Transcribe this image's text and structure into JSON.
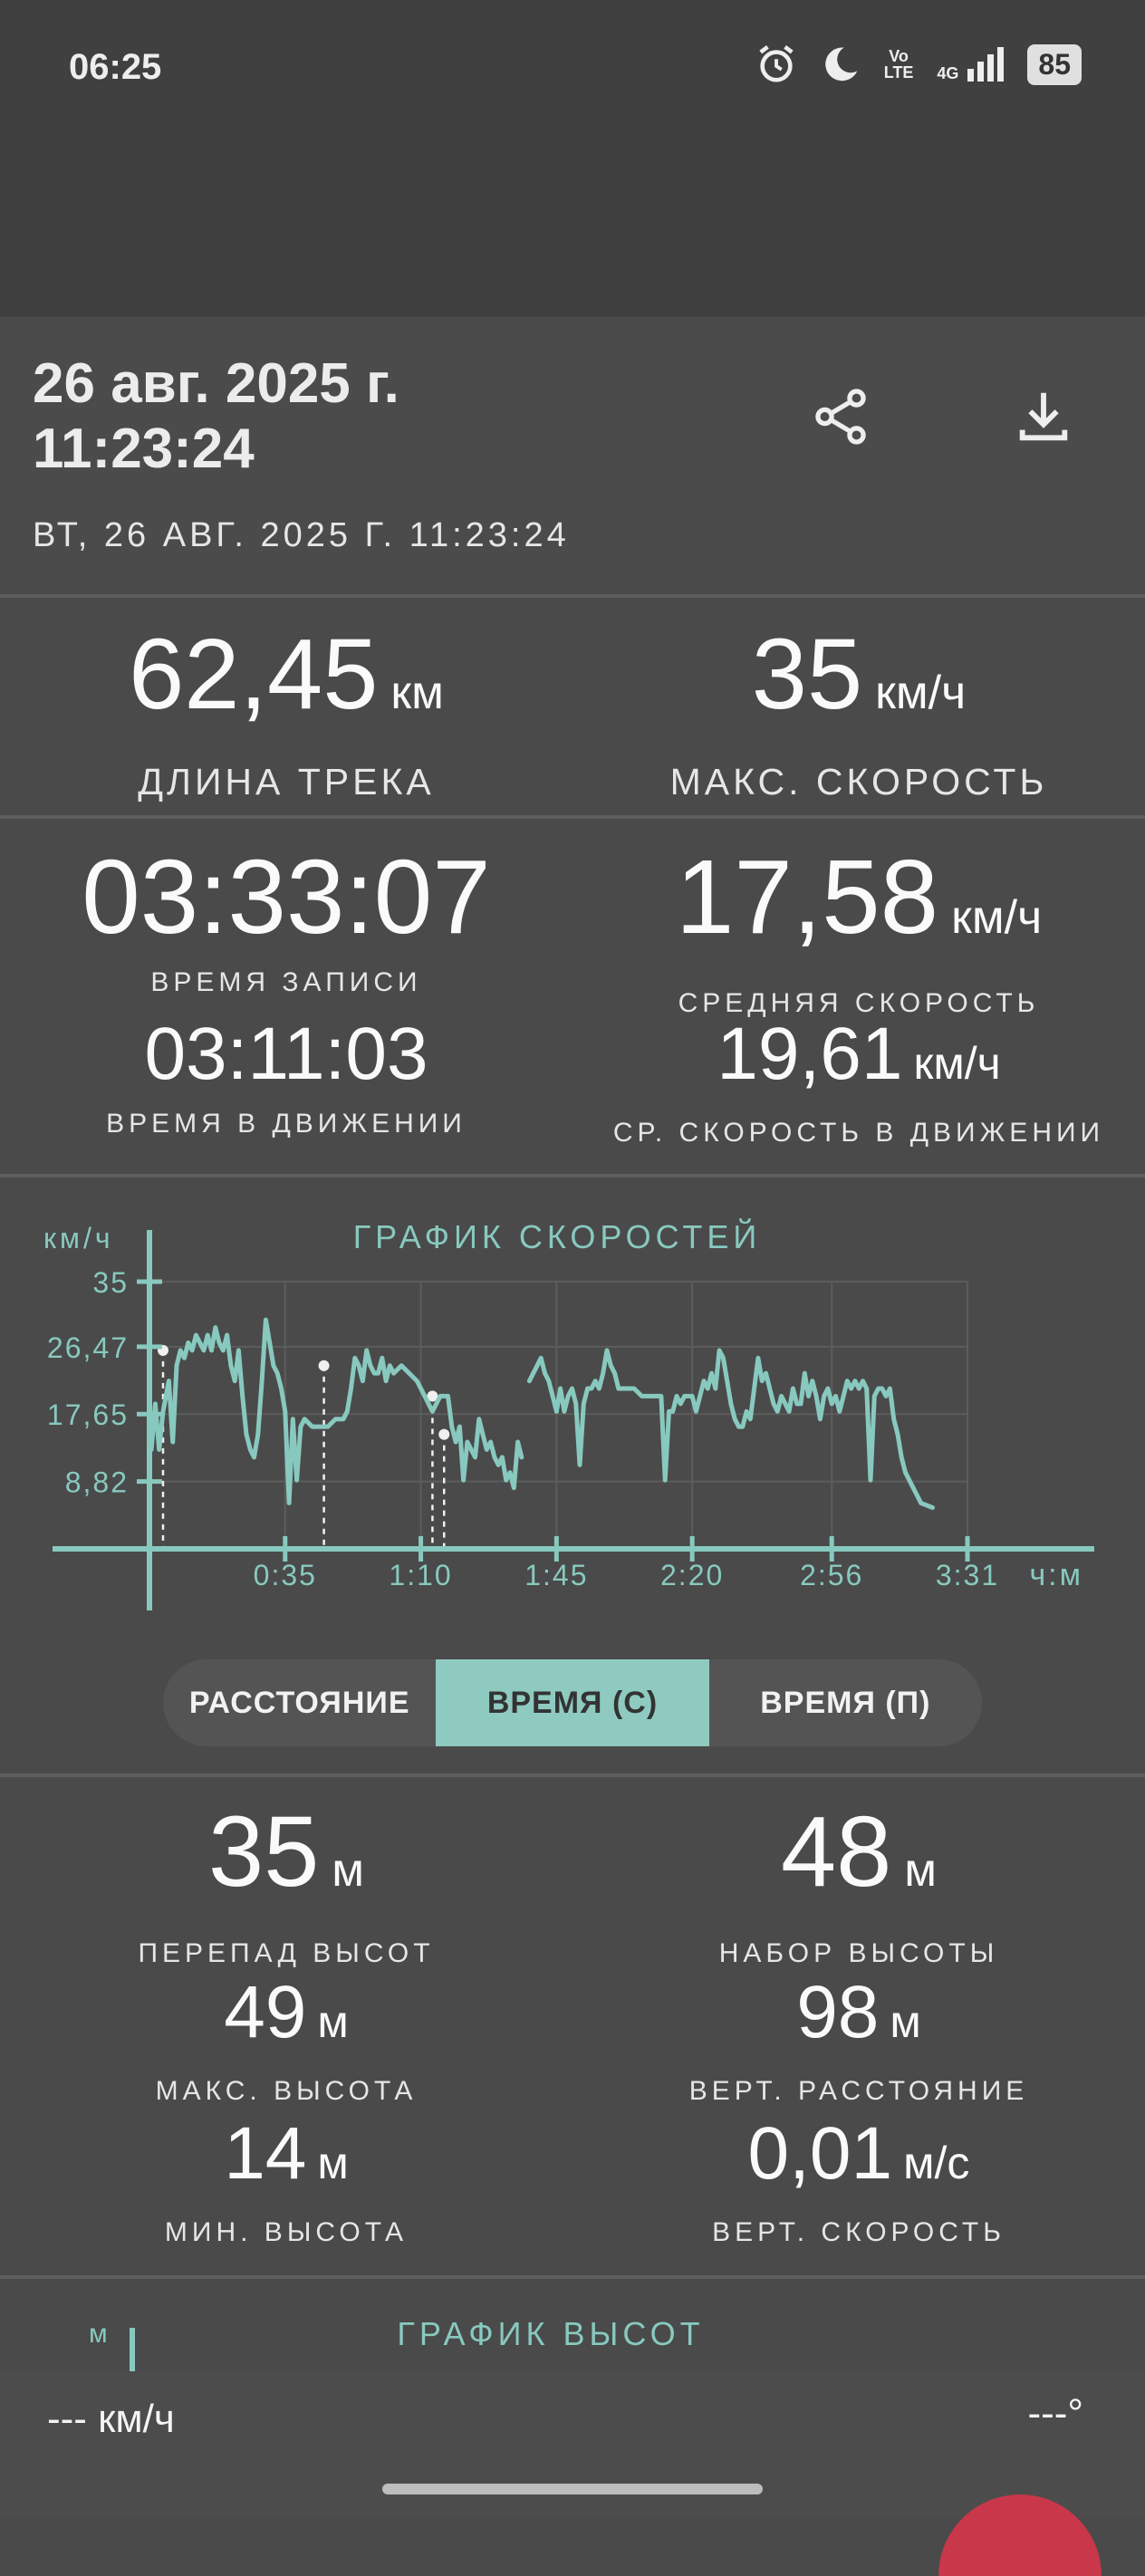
{
  "status_bar": {
    "time": "06:25",
    "icons": [
      "alarm-icon",
      "moon-icon",
      "volte-icon",
      "4g-icon",
      "signal-icon"
    ],
    "volte_top": "Vo",
    "volte_bottom": "LTE",
    "network": "4G",
    "battery": "85"
  },
  "header": {
    "title": "26 авг. 2025 г. 11:23:24",
    "subtitle": "ВТ, 26 АВГ. 2025 Г. 11:23:24",
    "share_icon": "share-icon",
    "download_icon": "download-icon"
  },
  "stats": {
    "track_length": {
      "value": "62,45",
      "unit": "км",
      "label": "ДЛИНА ТРЕКА"
    },
    "max_speed": {
      "value": "35",
      "unit": "км/ч",
      "label": "МАКС. СКОРОСТЬ"
    },
    "record_time": {
      "value": "03:33:07",
      "label": "ВРЕМЯ ЗАПИСИ"
    },
    "avg_speed": {
      "value": "17,58",
      "unit": "км/ч",
      "label": "СРЕДНЯЯ СКОРОСТЬ"
    },
    "moving_time": {
      "value": "03:11:03",
      "label": "ВРЕМЯ В ДВИЖЕНИИ"
    },
    "avg_moving_speed": {
      "value": "19,61",
      "unit": "км/ч",
      "label": "СР. СКОРОСТЬ В ДВИЖЕНИИ"
    }
  },
  "chart_data": {
    "type": "line",
    "title": "ГРАФИК СКОРОСТЕЙ",
    "ylabel": "км/ч",
    "xlabel": "ч:м",
    "y_ticks": [
      "35",
      "26,47",
      "17,65",
      "8,82"
    ],
    "x_ticks": [
      "0:35",
      "1:10",
      "1:45",
      "2:20",
      "2:56",
      "3:31"
    ],
    "ylim": [
      0,
      35
    ],
    "xlim_minutes": [
      0,
      211
    ],
    "grid": true,
    "color": "#88c9bf",
    "series": [
      {
        "points": [
          [
            0.5,
            13
          ],
          [
            1.5,
            19
          ],
          [
            2.5,
            13
          ],
          [
            3.5,
            18
          ],
          [
            5,
            22
          ],
          [
            6,
            14
          ],
          [
            7,
            24
          ],
          [
            8,
            26
          ],
          [
            9,
            25
          ],
          [
            10,
            27
          ],
          [
            11,
            26
          ],
          [
            12,
            28
          ],
          [
            13,
            27
          ],
          [
            14,
            26
          ],
          [
            15,
            28
          ],
          [
            16,
            26
          ],
          [
            17,
            29
          ],
          [
            18,
            27
          ],
          [
            19,
            26
          ],
          [
            20,
            28
          ],
          [
            21,
            24
          ],
          [
            22,
            22
          ],
          [
            23,
            26
          ],
          [
            24,
            20
          ],
          [
            25,
            15
          ],
          [
            26,
            13
          ],
          [
            27,
            12
          ],
          [
            28,
            15
          ],
          [
            29,
            22
          ],
          [
            30,
            30
          ],
          [
            31,
            27
          ],
          [
            32,
            24
          ],
          [
            33,
            23
          ],
          [
            34,
            21
          ],
          [
            35,
            18
          ],
          [
            36,
            6
          ],
          [
            37,
            17
          ],
          [
            38,
            9
          ],
          [
            39,
            16
          ],
          [
            40,
            17
          ],
          [
            42,
            16
          ],
          [
            44,
            16
          ],
          [
            46,
            16
          ],
          [
            48,
            17
          ],
          [
            50,
            17
          ],
          [
            51,
            18
          ],
          [
            52,
            21
          ],
          [
            53,
            25
          ],
          [
            54,
            24
          ],
          [
            55,
            22
          ],
          [
            56,
            26
          ],
          [
            57,
            24
          ],
          [
            58,
            23
          ],
          [
            59,
            23
          ],
          [
            60,
            25
          ],
          [
            61,
            22
          ],
          [
            62,
            24
          ],
          [
            63,
            23
          ],
          [
            65,
            24
          ],
          [
            67,
            23
          ],
          [
            69,
            22
          ],
          [
            71,
            20
          ],
          [
            72,
            19
          ],
          [
            73,
            18
          ],
          [
            75,
            20
          ],
          [
            77,
            20
          ],
          [
            78,
            16
          ],
          [
            79,
            14
          ],
          [
            80,
            16
          ],
          [
            81,
            9
          ],
          [
            82,
            14
          ],
          [
            83,
            13
          ],
          [
            84,
            12
          ],
          [
            85,
            17
          ],
          [
            86,
            15
          ],
          [
            87,
            13
          ],
          [
            88,
            14
          ],
          [
            89,
            12
          ],
          [
            90,
            11
          ],
          [
            91,
            12
          ],
          [
            92,
            9
          ],
          [
            93,
            10
          ],
          [
            94,
            8
          ],
          [
            95,
            14
          ],
          [
            96,
            12
          ],
          null,
          [
            98,
            22
          ],
          [
            99,
            23
          ],
          [
            100,
            24
          ],
          [
            101,
            25
          ],
          [
            102,
            23
          ],
          [
            103,
            22
          ],
          [
            104,
            20
          ],
          [
            105,
            18
          ],
          [
            106,
            21
          ],
          [
            107,
            18
          ],
          [
            108,
            20
          ],
          [
            109,
            21
          ],
          [
            110,
            19
          ],
          [
            111,
            11
          ],
          [
            112,
            19
          ],
          [
            113,
            21
          ],
          [
            114,
            21
          ],
          [
            115,
            22
          ],
          [
            116,
            21
          ],
          [
            117,
            23
          ],
          [
            118,
            26
          ],
          [
            119,
            24
          ],
          [
            120,
            23
          ],
          [
            121,
            21
          ],
          [
            123,
            21
          ],
          [
            125,
            21
          ],
          [
            127,
            20
          ],
          [
            129,
            20
          ],
          [
            131,
            20
          ],
          [
            132,
            20
          ],
          [
            133,
            9
          ],
          [
            134,
            18
          ],
          [
            135,
            18
          ],
          [
            136,
            20
          ],
          [
            137,
            19
          ],
          [
            138,
            20
          ],
          [
            139,
            20
          ],
          [
            140,
            20
          ],
          [
            141,
            18
          ],
          [
            142,
            20
          ],
          [
            143,
            22
          ],
          [
            144,
            21
          ],
          [
            145,
            23
          ],
          [
            146,
            21
          ],
          [
            147,
            26
          ],
          [
            148,
            25
          ],
          [
            149,
            22
          ],
          [
            150,
            19
          ],
          [
            151,
            17
          ],
          [
            152,
            16
          ],
          [
            153,
            16
          ],
          [
            154,
            18
          ],
          [
            155,
            17
          ],
          [
            156,
            21
          ],
          [
            157,
            25
          ],
          [
            158,
            22
          ],
          [
            159,
            23
          ],
          [
            160,
            21
          ],
          [
            161,
            19
          ],
          [
            162,
            18
          ],
          [
            163,
            20
          ],
          [
            164,
            19
          ],
          [
            165,
            18
          ],
          [
            166,
            21
          ],
          [
            167,
            19
          ],
          [
            168,
            19
          ],
          [
            169,
            23
          ],
          [
            170,
            20
          ],
          [
            171,
            22
          ],
          [
            172,
            20
          ],
          [
            173,
            17
          ],
          [
            174,
            20
          ],
          [
            175,
            21
          ],
          [
            176,
            19
          ],
          [
            177,
            20
          ],
          [
            178,
            18
          ],
          [
            179,
            20
          ],
          [
            180,
            22
          ],
          [
            181,
            21
          ],
          [
            182,
            22
          ],
          [
            183,
            21
          ],
          [
            184,
            22
          ],
          [
            185,
            21
          ],
          [
            186,
            9
          ],
          [
            187,
            20
          ],
          [
            188,
            21
          ],
          [
            189,
            21
          ],
          [
            190,
            20
          ],
          [
            191,
            21
          ],
          [
            192,
            17
          ],
          [
            193,
            15
          ],
          [
            194,
            12
          ],
          [
            195,
            10
          ],
          [
            196,
            9
          ],
          [
            197,
            8
          ],
          [
            198,
            7
          ],
          [
            199,
            6
          ],
          [
            200,
            5.8
          ],
          [
            202,
            5.4
          ]
        ]
      }
    ],
    "markers_minutes": [
      [
        3.5,
        26
      ],
      [
        45,
        24
      ],
      [
        73,
        20
      ],
      [
        76,
        15
      ]
    ]
  },
  "toggle": {
    "options": [
      "РАССТОЯНИЕ",
      "ВРЕМЯ (С)",
      "ВРЕМЯ (П)"
    ],
    "selected": "ВРЕМЯ (С)"
  },
  "elevation": {
    "difference": {
      "value": "35",
      "unit": "м",
      "label": "ПЕРЕПАД ВЫСОТ"
    },
    "gain": {
      "value": "48",
      "unit": "м",
      "label": "НАБОР ВЫСОТЫ"
    },
    "max": {
      "value": "49",
      "unit": "м",
      "label": "МАКС. ВЫСОТА"
    },
    "vert_distance": {
      "value": "98",
      "unit": "м",
      "label": "ВЕРТ. РАССТОЯНИЕ"
    },
    "min": {
      "value": "14",
      "unit": "м",
      "label": "МИН. ВЫСОТА"
    },
    "vert_speed": {
      "value": "0,01",
      "unit": "м/с",
      "label": "ВЕРТ. СКОРОСТЬ"
    },
    "chart_title": "ГРАФИК ВЫСОТ",
    "chart_unit": "м"
  },
  "bottom_bar": {
    "speed": "--- км/ч",
    "heading": "---°"
  }
}
